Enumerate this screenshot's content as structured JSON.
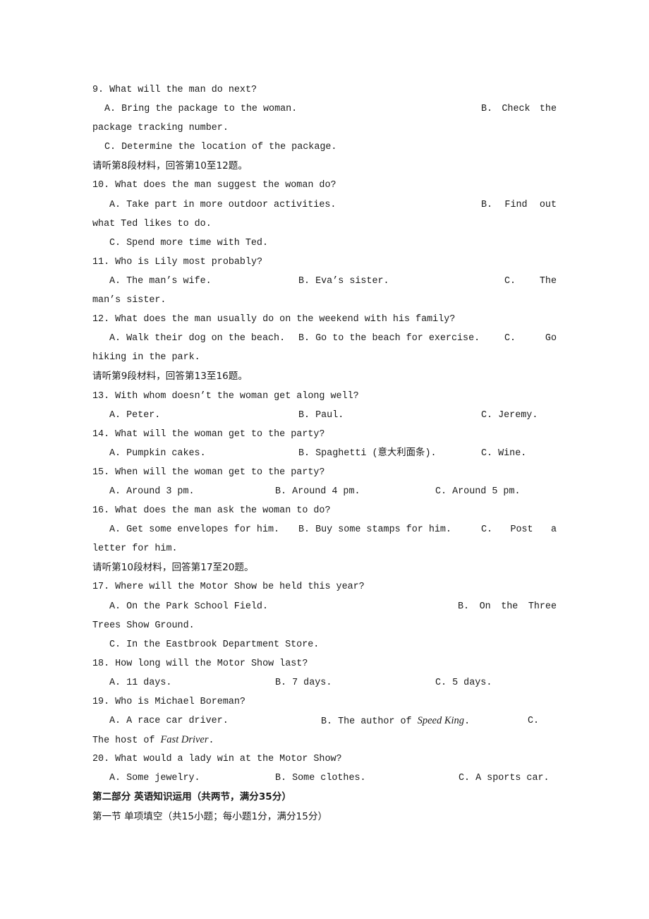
{
  "questions": {
    "q9": {
      "stem": "9. What will the man do next?",
      "a": "A. Bring the package to the woman.",
      "b_parts": [
        "B.",
        "Check",
        "the"
      ],
      "b_cont": "package tracking number.",
      "c": "C. Determine the location of the package."
    },
    "sec8": "请听第8段材料，回答第10至12题。",
    "q10": {
      "stem": "10. What does the man suggest the woman do?",
      "a": "A. Take part in more outdoor activities.",
      "b_parts": [
        "B.",
        "Find",
        "out"
      ],
      "b_cont": "what Ted likes to do.",
      "c": "C. Spend more time with Ted."
    },
    "q11": {
      "stem": "11. Who is Lily most probably?",
      "a": "A. The man’s wife.",
      "b": "B. Eva’s sister.",
      "c_parts": [
        "C.",
        "The"
      ],
      "c_cont": "man’s sister."
    },
    "q12": {
      "stem": "12. What does the man usually do on the weekend with his family?",
      "a": "A. Walk their dog on the beach.",
      "b": "B. Go to the beach for exercise.",
      "c_parts": [
        "C.",
        "Go"
      ],
      "c_cont": "hiking in the park."
    },
    "sec9": "请听第9段材料，回答第13至16题。",
    "q13": {
      "stem": "13. With whom doesn’t the woman get along well?",
      "a": "A. Peter.",
      "b": "B. Paul.",
      "c": "C. Jeremy."
    },
    "q14": {
      "stem": "14. What will the woman get to the party?",
      "a": "A. Pumpkin cakes.",
      "b": "B. Spaghetti (意大利面条).",
      "c": "C. Wine."
    },
    "q15": {
      "stem": "15. When will the woman get to the party?",
      "a": "A. Around 3 pm.",
      "b": "B. Around 4 pm.",
      "c": "C. Around 5 pm."
    },
    "q16": {
      "stem": "16. What does the man ask the woman to do?",
      "a": "A. Get some envelopes for him.",
      "b": "B. Buy some stamps for him.",
      "c_parts": [
        "C.",
        "Post",
        "a"
      ],
      "c_cont": "letter for him."
    },
    "sec10": "请听第10段材料，回答第17至20题。",
    "q17": {
      "stem": "17. Where will the Motor Show be held this year?",
      "a": "A. On the Park School Field.",
      "b_parts": [
        "B.",
        "On",
        "the",
        "Three"
      ],
      "b_cont": "Trees Show Ground.",
      "c": "C. In the Eastbrook Department Store."
    },
    "q18": {
      "stem": "18. How long will the Motor Show last?",
      "a": "A. 11 days.",
      "b": "B. 7 days.",
      "c": "C. 5 days."
    },
    "q19": {
      "stem": "19. Who is Michael Boreman?",
      "a": "A. A race car driver.",
      "b_pre": "B. The author of ",
      "b_title": "Speed King",
      "b_post": ".",
      "c_label": "C.",
      "c_pre": "The host of ",
      "c_title": "Fast Driver",
      "c_post": "."
    },
    "q20": {
      "stem": "20. What would a lady win at the Motor Show?",
      "a": "A. Some jewelry.",
      "b": "B. Some clothes.",
      "c": "C. A sports car."
    }
  },
  "part2": {
    "heading": "第二部分 英语知识运用（共两节，满分35分）",
    "section1": "第一节 单项填空（共15小题；每小题1分，满分15分）"
  }
}
